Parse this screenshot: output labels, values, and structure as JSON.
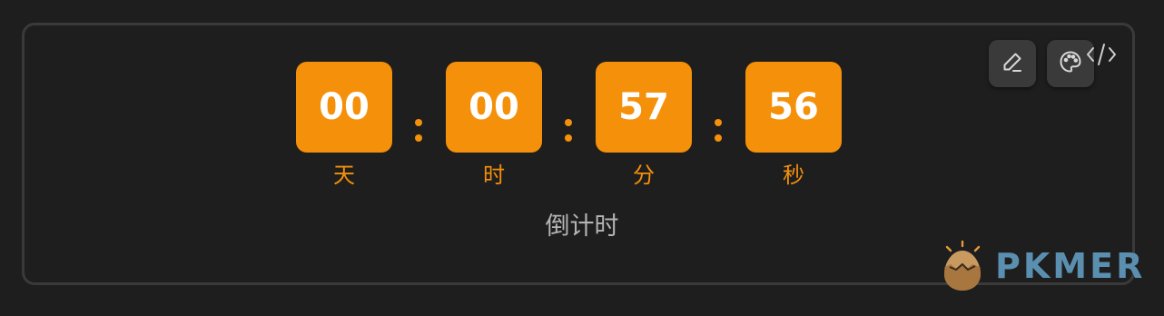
{
  "countdown": {
    "days": "00",
    "hours": "00",
    "minutes": "57",
    "seconds": "56",
    "separator": ":",
    "labels": {
      "days": "天",
      "hours": "时",
      "minutes": "分",
      "seconds": "秒"
    },
    "caption": "倒计时",
    "accent_color": "#f5900a"
  },
  "toolbar": {
    "edit_icon": "pencil-icon",
    "theme_icon": "palette-icon",
    "code_icon": "code-icon"
  },
  "watermark": {
    "brand": "PKMER",
    "logo_icon": "egg-logo-icon"
  }
}
